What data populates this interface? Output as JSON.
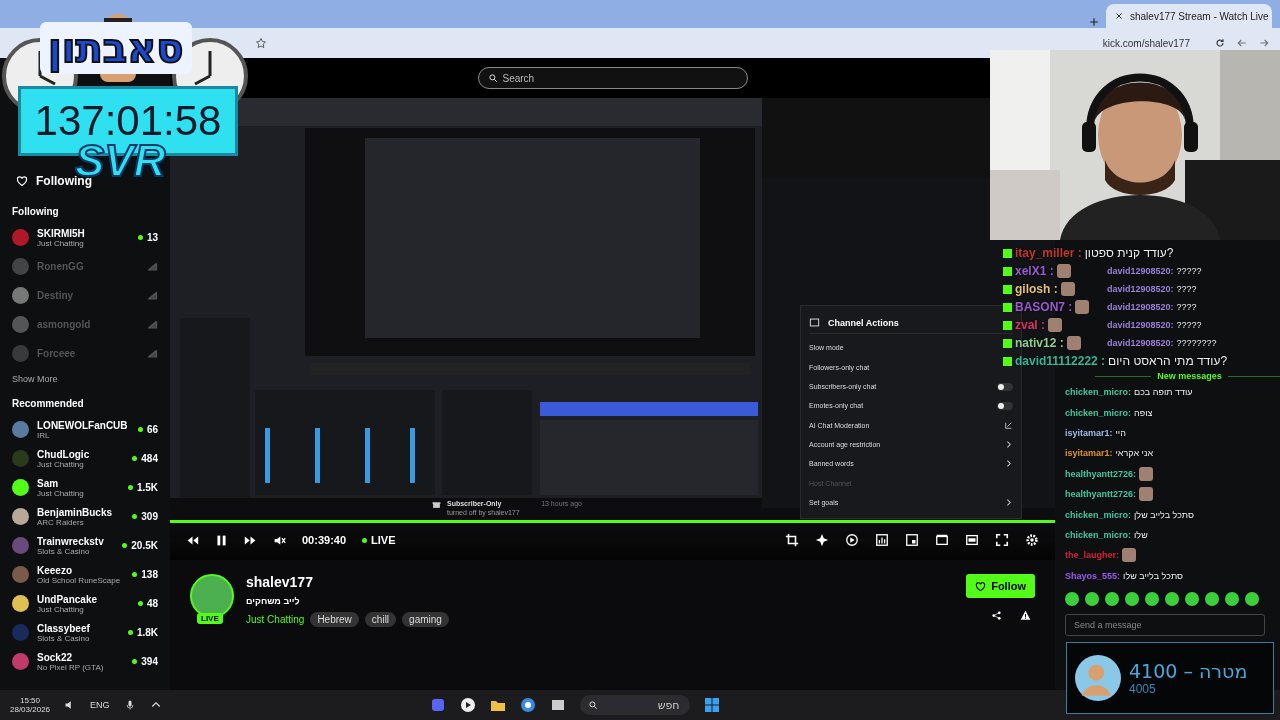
{
  "browser": {
    "tab_title": "shalev177 Stream - Watch Live",
    "url": "kick.com/shalev177"
  },
  "header": {
    "search": {
      "placeholder": "Search"
    }
  },
  "overlay": {
    "logo": "סאבתון",
    "timer": "137:01:58",
    "tag": "SVR"
  },
  "sidebar": {
    "nav": {
      "label": "Following",
      "selected": true
    },
    "following_title": "Following",
    "following": [
      {
        "name": "SKIRMI5H",
        "category": "Just Chatting",
        "viewers": "13",
        "live": true,
        "color": "#b0182a"
      },
      {
        "name": "RonenGG",
        "live": false,
        "color": "#444444"
      },
      {
        "name": "Destiny",
        "live": false,
        "color": "#777777"
      },
      {
        "name": "asmongold",
        "live": false,
        "color": "#555555"
      },
      {
        "name": "Forceee",
        "live": false,
        "color": "#3a3a3a"
      }
    ],
    "show_more": "Show More",
    "recommended_title": "Recommended",
    "recommended": [
      {
        "name": "LONEWOLFanCUB",
        "category": "IRL",
        "viewers": "66",
        "live": true,
        "color": "#5b7aa0"
      },
      {
        "name": "ChudLogic",
        "category": "Just Chatting",
        "viewers": "484",
        "live": true,
        "color": "#2a3a1a"
      },
      {
        "name": "Sam",
        "category": "Just Chatting",
        "viewers": "1.5K",
        "live": true,
        "color": "#53fc18"
      },
      {
        "name": "BenjaminBucks",
        "category": "ARC Raiders",
        "viewers": "309",
        "live": true,
        "color": "#b8a898"
      },
      {
        "name": "Trainwreckstv",
        "category": "Slots & Casino",
        "viewers": "20.5K",
        "live": true,
        "color": "#6a4a7a"
      },
      {
        "name": "Keeezo",
        "category": "Old School RuneScape",
        "viewers": "138",
        "live": true,
        "color": "#7a5a4a"
      },
      {
        "name": "UndPancake",
        "category": "Just Chatting",
        "viewers": "48",
        "live": true,
        "color": "#e0c050"
      },
      {
        "name": "Classybeef",
        "category": "Slots & Casino",
        "viewers": "1.8K",
        "live": true,
        "color": "#1a2a5a"
      },
      {
        "name": "Sock22",
        "category": "No Pixel RP (GTA)",
        "viewers": "394",
        "live": true,
        "color": "#c03a6a"
      }
    ]
  },
  "channel_actions": {
    "title": "Channel Actions",
    "items": [
      {
        "label": "Slow mode",
        "kind": "plain",
        "disabled": false
      },
      {
        "label": "Followers-only chat",
        "kind": "plain",
        "disabled": false
      },
      {
        "label": "Subscribers-only chat",
        "kind": "toggle",
        "on": false,
        "disabled": false
      },
      {
        "label": "Emotes-only chat",
        "kind": "toggle",
        "on": false,
        "disabled": false
      },
      {
        "label": "AI Chat Moderation",
        "kind": "external",
        "disabled": false
      },
      {
        "label": "Account age restriction",
        "kind": "chevron",
        "disabled": false
      },
      {
        "label": "Banned words",
        "kind": "chevron",
        "disabled": false
      },
      {
        "label": "Host Channel",
        "kind": "plain",
        "disabled": true
      },
      {
        "label": "Set goals",
        "kind": "chevron",
        "disabled": false
      }
    ]
  },
  "notification": {
    "title": "Subscriber-Only",
    "detail": "turned off by shalev177",
    "time": "13 hours ago"
  },
  "player": {
    "time": "00:39:40",
    "live": "LIVE",
    "paused": false
  },
  "channel": {
    "name": "shalev177",
    "title": "לייב משחקים",
    "badge": "LIVE",
    "category": "Just Chatting",
    "tags": [
      "Hebrew",
      "chill",
      "gaming"
    ],
    "follow": "Follow"
  },
  "chat_overlay": [
    {
      "name": "itay_miller :",
      "color": "#c0392b",
      "message": "עודד קנית ספטון?"
    },
    {
      "name": "xelX1 :",
      "color": "#9b59d0"
    },
    {
      "name": "gilosh :",
      "color": "#e8c07a"
    },
    {
      "name": "BASON7 :",
      "color": "#9b59d0"
    },
    {
      "name": "zval :",
      "color": "#e0306a"
    },
    {
      "name": "nativ12 :",
      "color": "#8fd08f"
    },
    {
      "name": "david11112222 :",
      "color": "#2fb89a",
      "message": "עודד מתי הראסט היום?"
    }
  ],
  "chat": {
    "older": [
      {
        "name": "david12908520:",
        "color": "#9b7fd8",
        "message": "?????"
      },
      {
        "name": "david12908520:",
        "color": "#9b7fd8",
        "message": "????"
      },
      {
        "name": "david12908520:",
        "color": "#9b7fd8",
        "message": "????"
      },
      {
        "name": "david12908520:",
        "color": "#9b7fd8",
        "message": "?????"
      },
      {
        "name": "david12908520:",
        "color": "#9b7fd8",
        "message": "????????"
      }
    ],
    "divider": "New messages",
    "messages": [
      {
        "name": "chicken_micro:",
        "color": "#3fc7a0",
        "message": "עודד תופה בכם"
      },
      {
        "name": "chicken_micro:",
        "color": "#3fc7a0",
        "message": "צופה"
      },
      {
        "name": "isyitamar1:",
        "color": "#a0b8e8",
        "message": "היי"
      },
      {
        "name": "isyitamar1:",
        "color": "#e0902a",
        "message": "אני אקראי"
      },
      {
        "name": "healthyantt2726:",
        "color": "#3fc7a0",
        "emote": true
      },
      {
        "name": "healthyantt2726:",
        "color": "#3fc7a0",
        "emote": true
      },
      {
        "name": "chicken_micro:",
        "color": "#3fc7a0",
        "message": "סתכל בלייב שלן"
      },
      {
        "name": "chicken_micro:",
        "color": "#3fc7a0",
        "message": "שלו"
      },
      {
        "name": "the_laugher:",
        "color": "#d0203a",
        "emote": true
      },
      {
        "name": "Shayos_555:",
        "color": "#9b59f0",
        "message": "סתכל בלייב שלו"
      }
    ],
    "input": {
      "placeholder": "Send a message"
    }
  },
  "goal": {
    "label": "4100 – מטרה",
    "current": "4005"
  },
  "taskbar": {
    "time": "15:50",
    "date": "28/03/2026",
    "language": "ENG",
    "search": {
      "placeholder": "חפש"
    }
  }
}
